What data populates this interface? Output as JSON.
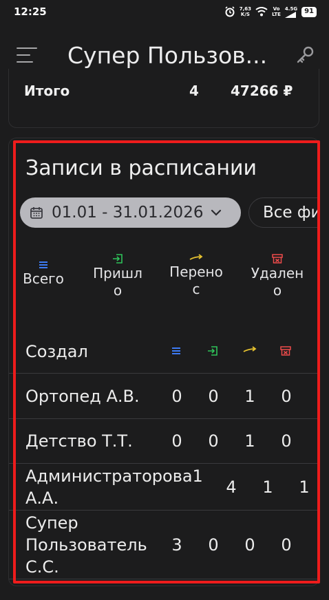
{
  "status": {
    "time": "12:25",
    "speed": "7,63",
    "speed_unit": "K/S",
    "volte": "Vo",
    "lte": "LTE",
    "network": "4.5G",
    "battery": "91"
  },
  "app_bar": {
    "title": "Супер Пользов..."
  },
  "summary": {
    "label": "Итого",
    "count": "4",
    "amount": "47266 ₽"
  },
  "schedule": {
    "title": "Записи в расписании",
    "date_range": "01.01 - 31.01.2026",
    "filter_label": "Все фи",
    "legend": {
      "total": "Всего",
      "arrived_line1": "Пришл",
      "arrived_line2": "о",
      "moved_line1": "Перено",
      "moved_line2": "с",
      "deleted_line1": "Удален",
      "deleted_line2": "о"
    },
    "header": {
      "creator": "Создал"
    },
    "rows": [
      {
        "name_line1": "Ортопед А.В.",
        "name_line2": "",
        "name_line3": "",
        "total": "0",
        "arrived": "0",
        "moved": "1",
        "deleted": "0"
      },
      {
        "name_line1": "Детство Т.Т.",
        "name_line2": "",
        "name_line3": "",
        "total": "0",
        "arrived": "0",
        "moved": "1",
        "deleted": "0"
      },
      {
        "name_line1": "Администраторова1",
        "name_line2": "А.А.",
        "name_line3": "",
        "total": "",
        "arrived": "4",
        "moved": "1",
        "deleted": "1"
      },
      {
        "name_line1": "Супер",
        "name_line2": "Пользователь",
        "name_line3": "С.С.",
        "total": "3",
        "arrived": "0",
        "moved": "0",
        "deleted": "0"
      }
    ]
  },
  "colors": {
    "total": "#3d7bf5",
    "arrived": "#2ec45a",
    "moved": "#e5c12f",
    "deleted": "#ee4b4b",
    "highlight": "#ee1c1c"
  },
  "icons": [
    "alarm-icon",
    "wifi-icon",
    "battery-icon",
    "menu-icon",
    "key-icon",
    "calendar-icon",
    "chevron-down-icon",
    "list-icon",
    "login-icon",
    "arrow-right-icon",
    "trash-icon"
  ]
}
